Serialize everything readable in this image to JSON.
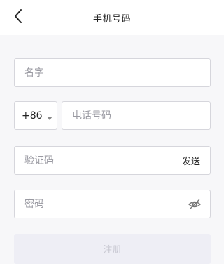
{
  "header": {
    "title": "手机号码"
  },
  "form": {
    "name_placeholder": "名字",
    "country_code": "+86",
    "phone_placeholder": "电话号码",
    "code_placeholder": "验证码",
    "send_label": "发送",
    "password_placeholder": "密码",
    "register_label": "注册"
  },
  "icons": {
    "back": "back-chevron-icon",
    "caret": "caret-down-icon",
    "password_visibility": "eye-off-icon"
  },
  "colors": {
    "page_background": "#f7f7f9",
    "field_border": "#d6d6dc",
    "placeholder_text": "#9a9aa2",
    "disabled_button_bg": "#eeeef5",
    "disabled_button_text": "#c6c6d0"
  }
}
